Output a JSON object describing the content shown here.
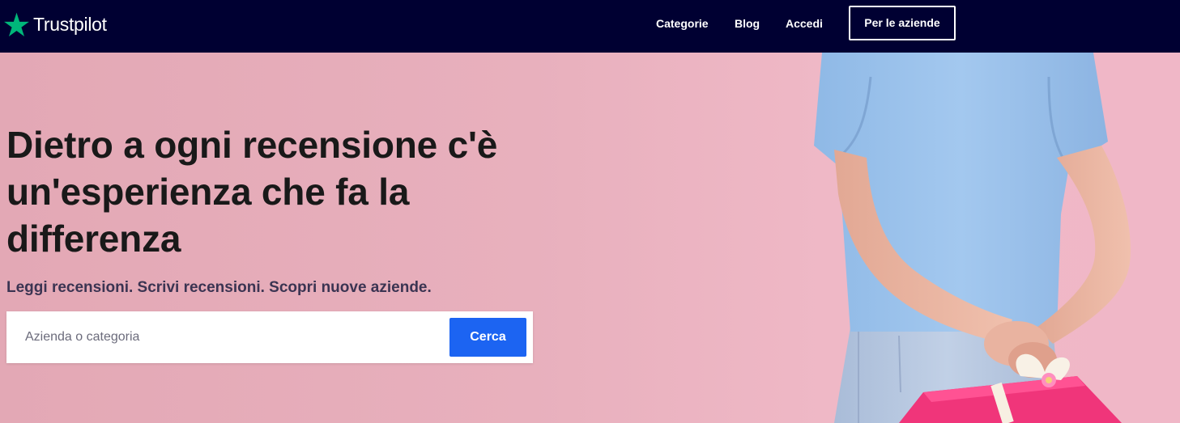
{
  "header": {
    "brand": "Trustpilot",
    "nav": {
      "categories": "Categorie",
      "blog": "Blog",
      "login": "Accedi"
    },
    "business_button": "Per le aziende"
  },
  "hero": {
    "headline": "Dietro a ogni recensione c'è un'esperienza che fa la differenza",
    "tagline": "Leggi recensioni. Scrivi recensioni. Scopri nuove aziende.",
    "search": {
      "placeholder": "Azienda o categoria",
      "value": "",
      "button": "Cerca"
    }
  },
  "colors": {
    "header_bg": "#000032",
    "brand_star": "#00b67a",
    "hero_bg": "#e8b0bd",
    "search_button": "#1c64f2",
    "headline_text": "#191919"
  },
  "icons": {
    "logo": "star-icon"
  }
}
